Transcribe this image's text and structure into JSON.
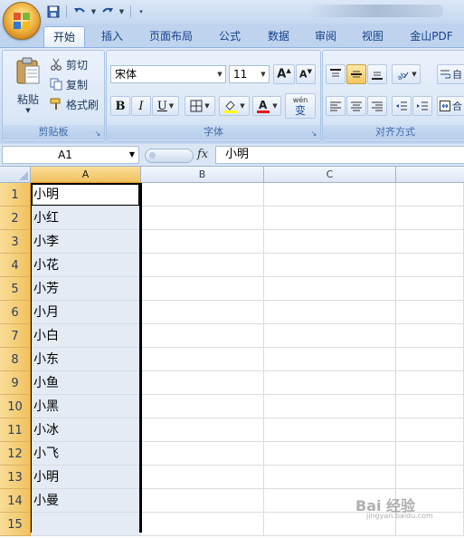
{
  "quick_access": {
    "save": "save-icon",
    "undo": "undo-icon",
    "redo": "redo-icon"
  },
  "tabs": [
    "开始",
    "插入",
    "页面布局",
    "公式",
    "数据",
    "审阅",
    "视图",
    "金山PDF"
  ],
  "clipboard": {
    "paste": "粘贴",
    "cut": "剪切",
    "copy": "复制",
    "format_painter": "格式刷",
    "label": "剪贴板"
  },
  "font": {
    "name": "宋体",
    "size": "11",
    "label": "字体",
    "bold": "B",
    "italic": "I",
    "underline": "U",
    "phonetic": "wén",
    "phonetic_char": "变"
  },
  "alignment": {
    "label": "对齐方式",
    "wrap_text": "自",
    "merge": "合"
  },
  "formula_bar": {
    "name_box": "A1",
    "fx": "fx",
    "content": "小明"
  },
  "columns": [
    "A",
    "B",
    "C"
  ],
  "rows": [
    "1",
    "2",
    "3",
    "4",
    "5",
    "6",
    "7",
    "8",
    "9",
    "10",
    "11",
    "12",
    "13",
    "14",
    "15"
  ],
  "cells_a": [
    "小明",
    "小红",
    "小李",
    "小花",
    "小芳",
    "小月",
    "小白",
    "小东",
    "小鱼",
    "小黑",
    "小冰",
    "小飞",
    "小明",
    "小曼",
    ""
  ],
  "watermark": {
    "main": "Bai 经验",
    "sub": "jingyan.baidu.com"
  },
  "colors": {
    "accent": "#15428b",
    "selected_header": "#f1c15f",
    "selected_fill": "#e4ebf5"
  }
}
